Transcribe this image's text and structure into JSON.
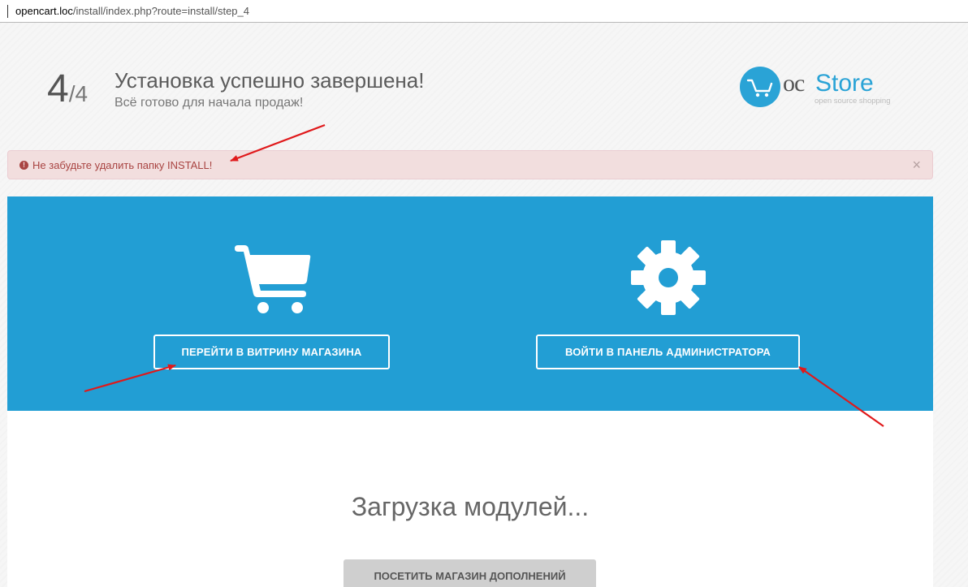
{
  "browser": {
    "url_host": "opencart.loc",
    "url_path": "/install/index.php?route=install/step_4"
  },
  "header": {
    "step_current": "4",
    "step_total": "/4",
    "title": "Установка успешно завершена!",
    "subtitle": "Всё готово для начала продаж!"
  },
  "logo": {
    "oc": "oc",
    "store": "Store",
    "tagline": "open source shopping"
  },
  "alert": {
    "icon": "!",
    "text": "Не забудьте удалить папку INSTALL!",
    "close": "×"
  },
  "actions": {
    "store_button": "ПЕРЕЙТИ В ВИТРИНУ МАГАЗИНА",
    "admin_button": "ВОЙТИ В ПАНЕЛЬ АДМИНИСТРАТОРА"
  },
  "modules": {
    "loading_text": "Загрузка модулей...",
    "addons_button": "ПОСЕТИТЬ МАГАЗИН ДОПОЛНЕНИЙ"
  },
  "colors": {
    "brand_blue": "#229ed4",
    "alert_bg": "#f2dede",
    "alert_text": "#a94442",
    "annotation_red": "#e0191b"
  },
  "icons": [
    "cart-icon",
    "gear-icon",
    "exclamation-circle-icon",
    "close-icon"
  ]
}
